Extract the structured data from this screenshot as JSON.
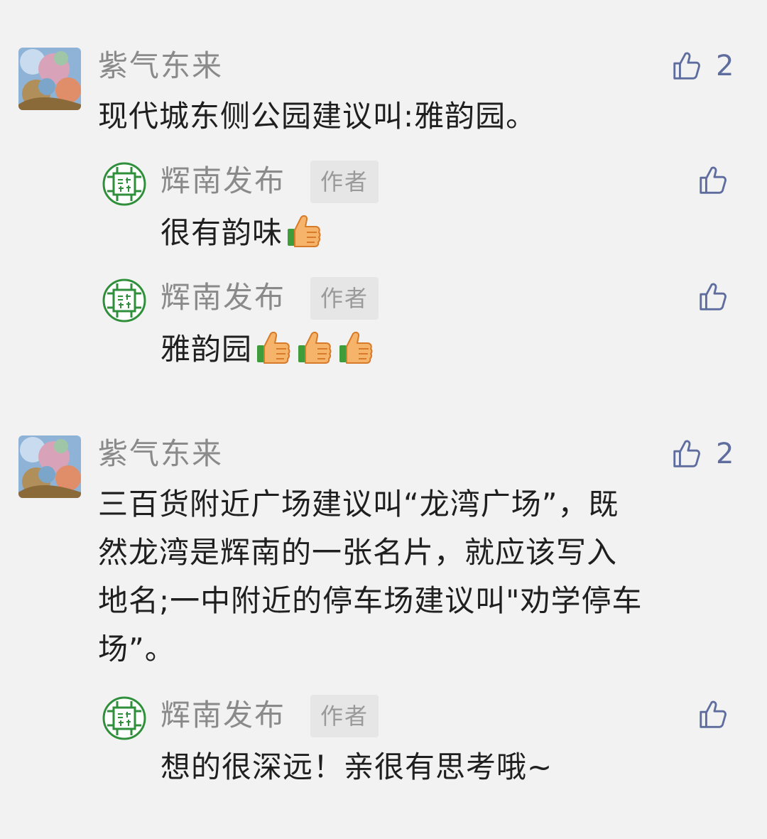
{
  "comments": [
    {
      "user": "紫气东来",
      "text": "现代城东侧公园建议叫:雅韵园。",
      "likes": "2",
      "replies": [
        {
          "user": "辉南发布",
          "badge": "作者",
          "text": "很有韵味",
          "emoji_icons": [
            "thumbs-up-icon"
          ]
        },
        {
          "user": "辉南发布",
          "badge": "作者",
          "text": "雅韵园",
          "emoji_icons": [
            "thumbs-up-icon",
            "thumbs-up-icon",
            "thumbs-up-icon"
          ]
        }
      ]
    },
    {
      "user": "紫气东来",
      "text_lines": [
        "三百货附近广场建议叫“龙湾广场”，既",
        "然龙湾是辉南的一张名片，就应该写入",
        "地名;一中附近的停车场建议叫\"劝学停车",
        "场”。"
      ],
      "likes": "2",
      "replies": [
        {
          "user": "辉南发布",
          "badge": "作者",
          "text": "想的很深远！亲很有思考哦~",
          "emoji_icons": []
        }
      ]
    }
  ],
  "colors": {
    "background": "#f2f2f2",
    "name": "#8a8a8a",
    "text": "#1f1f1f",
    "like": "#5e6d9e",
    "badge_bg": "#e6e6e6",
    "badge_text": "#9a9a9a",
    "logo_green": "#2f8f3a"
  }
}
